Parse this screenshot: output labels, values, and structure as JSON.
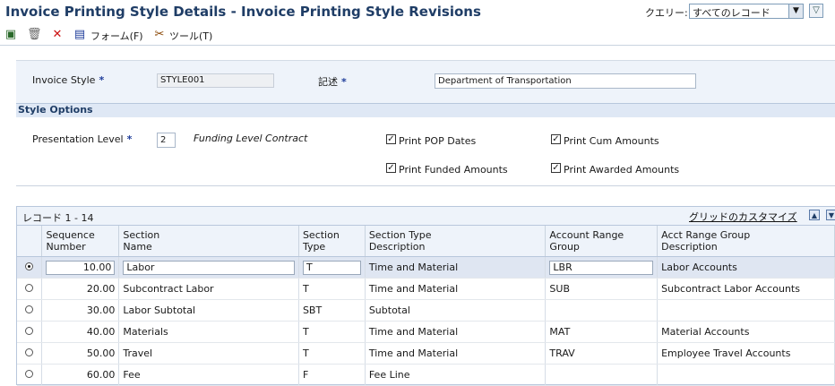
{
  "window": {
    "title": "Invoice Printing Style Details - Invoice Printing Style Revisions",
    "query_label": "クエリー:",
    "query_value": "すべてのレコード"
  },
  "toolbar": {
    "form_label": "フォーム(F)",
    "tools_label": "ツール(T)"
  },
  "header": {
    "invoice_style_label": "Invoice Style",
    "invoice_style_value": "STYLE001",
    "description_label": "記述",
    "description_value": "Department of Transportation",
    "required_mark": "*"
  },
  "style_options": {
    "section_title": "Style Options",
    "presentation_level_label": "Presentation Level",
    "presentation_level_value": "2",
    "presentation_level_desc": "Funding Level Contract",
    "checkboxes": [
      {
        "label": "Print POP Dates",
        "checked": true
      },
      {
        "label": "Print Cum Amounts",
        "checked": true
      },
      {
        "label": "Print Funded Amounts",
        "checked": true
      },
      {
        "label": "Print Awarded Amounts",
        "checked": true
      }
    ]
  },
  "grid": {
    "record_count": "レコード 1 - 14",
    "customize_link": "グリッドのカスタマイズ",
    "columns": [
      {
        "line1": "Sequence",
        "line2": "Number"
      },
      {
        "line1": "Section",
        "line2": "Name"
      },
      {
        "line1": "Section",
        "line2": "Type"
      },
      {
        "line1": "Section Type",
        "line2": "Description"
      },
      {
        "line1": "Account Range",
        "line2": "Group"
      },
      {
        "line1": "Acct Range Group",
        "line2": "Description"
      }
    ],
    "rows": [
      {
        "seq": "10.00",
        "name": "Labor",
        "type": "T",
        "type_desc": "Time and Material",
        "acct_group": "LBR",
        "acct_desc": "Labor Accounts"
      },
      {
        "seq": "20.00",
        "name": "Subcontract Labor",
        "type": "T",
        "type_desc": "Time and Material",
        "acct_group": "SUB",
        "acct_desc": "Subcontract Labor Accounts"
      },
      {
        "seq": "30.00",
        "name": "Labor Subtotal",
        "type": "SBT",
        "type_desc": "Subtotal",
        "acct_group": "",
        "acct_desc": ""
      },
      {
        "seq": "40.00",
        "name": "Materials",
        "type": "T",
        "type_desc": "Time and Material",
        "acct_group": "MAT",
        "acct_desc": "Material Accounts"
      },
      {
        "seq": "50.00",
        "name": "Travel",
        "type": "T",
        "type_desc": "Time and Material",
        "acct_group": "TRAV",
        "acct_desc": "Employee Travel Accounts"
      },
      {
        "seq": "60.00",
        "name": "Fee",
        "type": "F",
        "type_desc": "Fee Line",
        "acct_group": "",
        "acct_desc": ""
      }
    ]
  }
}
